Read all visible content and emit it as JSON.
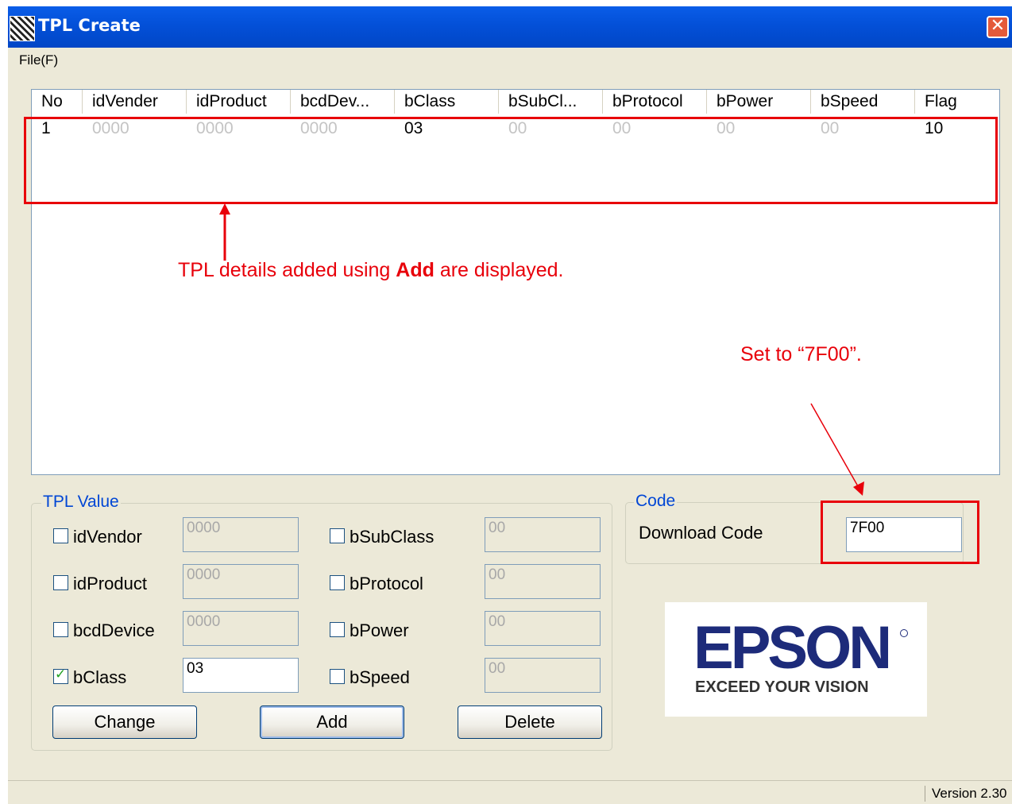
{
  "window": {
    "title": "TPL Create",
    "close_glyph": "✕"
  },
  "menu": {
    "file_label": "File(F)"
  },
  "list": {
    "columns": [
      "No",
      "idVender",
      "idProduct",
      "bcdDev...",
      "bClass",
      "bSubCl...",
      "bProtocol",
      "bPower",
      "bSpeed",
      "Flag"
    ],
    "rows": [
      [
        "1",
        "0000",
        "0000",
        "0000",
        "03",
        "00",
        "00",
        "00",
        "00",
        "10"
      ]
    ]
  },
  "annotations": {
    "list_note_pre": "TPL details added using ",
    "list_note_bold": "Add",
    "list_note_post": " are displayed.",
    "code_note": "Set to “7F00”."
  },
  "tpl_value": {
    "legend": "TPL Value",
    "fields": [
      {
        "label": "idVendor",
        "checked": false,
        "value": "0000"
      },
      {
        "label": "idProduct",
        "checked": false,
        "value": "0000"
      },
      {
        "label": "bcdDevice",
        "checked": false,
        "value": "0000"
      },
      {
        "label": "bClass",
        "checked": true,
        "value": "03"
      },
      {
        "label": "bSubClass",
        "checked": false,
        "value": "00"
      },
      {
        "label": "bProtocol",
        "checked": false,
        "value": "00"
      },
      {
        "label": "bPower",
        "checked": false,
        "value": "00"
      },
      {
        "label": "bSpeed",
        "checked": false,
        "value": "00"
      }
    ],
    "buttons": {
      "change": "Change",
      "add": "Add",
      "delete": "Delete"
    }
  },
  "code": {
    "legend": "Code",
    "label": "Download Code",
    "value": "7F00"
  },
  "logo": {
    "brand": "EPSON",
    "tagline": "EXCEED YOUR VISION"
  },
  "status": {
    "version": "Version 2.30"
  },
  "colors": {
    "title_bar": "#0350d8",
    "annotation_red": "#e8000a",
    "group_legend": "#0046d5",
    "brand_blue": "#1d2b7a"
  }
}
